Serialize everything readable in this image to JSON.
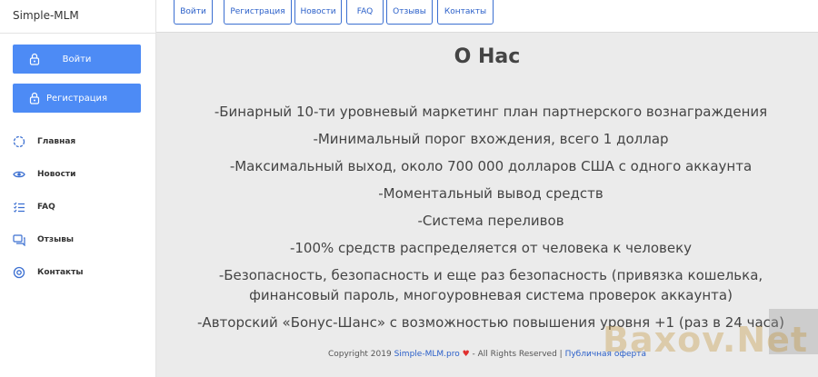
{
  "brand": "Simple-MLM",
  "sidebar": {
    "login_label": "Войти",
    "register_label": "Регистрация",
    "items": [
      {
        "label": "Главная",
        "icon": "globe-icon"
      },
      {
        "label": "Новости",
        "icon": "eye-icon"
      },
      {
        "label": "FAQ",
        "icon": "list-icon"
      },
      {
        "label": "Отзывы",
        "icon": "chat-icon"
      },
      {
        "label": "Контакты",
        "icon": "support-icon"
      }
    ]
  },
  "topnav": [
    "Войти",
    "Регистрация",
    "Новости",
    "FAQ",
    "Отзывы",
    "Контакты"
  ],
  "main": {
    "title": "О Нас",
    "lines": [
      "-Бинарный 10-ти уровневый маркетинг план партнерского вознаграждения",
      "-Минимальный порог вхождения, всего 1 доллар",
      "-Максимальный выход, около 700 000 долларов США с одного аккаунта",
      "-Моментальный вывод средств",
      "-Система переливов",
      "-100% средств распределяется от человека к человеку",
      "-Безопасность, безопасность и еще раз безопасность (привязка кошелька, финансовый пароль, многоуровневая система проверок аккаунта)",
      "-Авторский «Бонус-Шанс» с возможностью повышения уровня +1 (раз в 24 часа)"
    ]
  },
  "footer": {
    "copyright": "Copyright 2019",
    "site": "Simple-MLM.pro",
    "rights": "- All Rights Reserved |",
    "offer": "Публичная оферта"
  },
  "watermark": "Baxov.Net",
  "colors": {
    "accent": "#4d8bf5",
    "link": "#2a5fc9",
    "background": "#ebebeb"
  }
}
